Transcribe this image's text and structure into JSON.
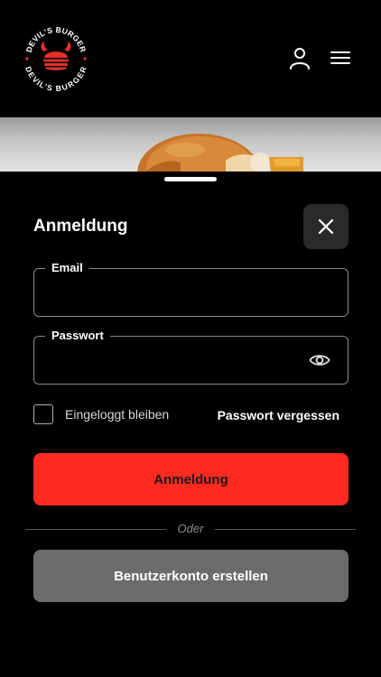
{
  "header": {
    "logo_top_text": "DEVIL'S BURGER",
    "logo_bottom_text": "DEVIL'S BURGER",
    "user_icon": "user-icon",
    "menu_icon": "hamburger-menu-icon"
  },
  "login": {
    "title": "Anmeldung",
    "close_icon": "close-icon",
    "email_label": "Email",
    "email_value": "",
    "password_label": "Passwort",
    "password_value": "",
    "eye_icon": "eye-icon",
    "remember_label": "Eingeloggt bleiben",
    "remember_checked": false,
    "forgot_label": "Passwort vergessen",
    "submit_label": "Anmeldung",
    "divider_text": "Oder",
    "register_label": "Benutzerkonto erstellen"
  },
  "colors": {
    "background": "#000000",
    "primary_button": "#ff2a1f",
    "secondary_button": "#6b6b6b",
    "logo_red": "#e4312b"
  }
}
